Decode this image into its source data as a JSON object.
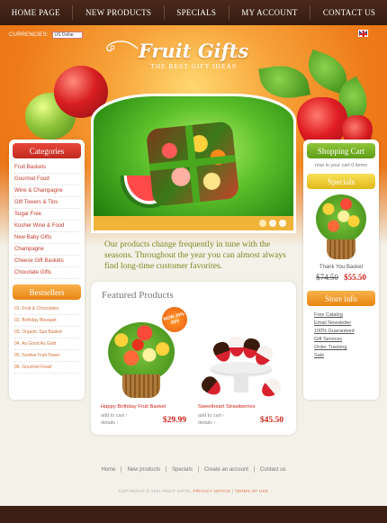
{
  "nav": {
    "items": [
      "HOME PAGE",
      "NEW PRODUCTS",
      "SPECIALS",
      "MY ACCOUNT",
      "CONTACT US"
    ]
  },
  "header": {
    "currencies_label": "CURRENCIES:",
    "currency_value": "US Dollar",
    "logo_title": "Fruit Gifts",
    "logo_subtitle": "THE BEST GIFT IDEAS"
  },
  "intro_text": "Our products change frequently in tune with the seasons. Throughout the year you can almost always find long-time customer favorites.",
  "categories": {
    "title": "Categories",
    "items": [
      "Fruit Baskets",
      "Gourmet Food",
      "Wine & Champagne",
      "Gift Towers & Tins",
      "Sugar Free",
      "Kosher Wine & Food",
      "New Baby Gifts",
      "Champagne",
      "Cheese Gift Baskets",
      "Chocolate Gifts"
    ]
  },
  "bestsellers": {
    "title": "Bestsellers",
    "items": [
      "01. Fruit & Chocolates",
      "02. Birthday Bouquet",
      "03. Organic Spa Basket",
      "04. As Good As Gold",
      "05. Festive Fruit Tower",
      "06. Gourmet Feast"
    ]
  },
  "cart": {
    "title": "Shopping Cart",
    "text": "now in your cart 0 items"
  },
  "specials": {
    "title": "Specials",
    "product_name": "Thank You Basket",
    "old_price": "$74.50",
    "new_price": "$55.50"
  },
  "store_info": {
    "title": "Store info",
    "links": [
      "Free Catalog",
      "Email Newsletter",
      "100% Guaranteed",
      "Gift Services",
      "Order Tracking",
      "Sale"
    ]
  },
  "featured": {
    "title": "Featured Products",
    "badge": "NOW 20% OFF",
    "products": [
      {
        "name": "Happy Birthday Fruit Basket",
        "add_to_cart": "add to cart",
        "details": "details",
        "price": "$29.99"
      },
      {
        "name": "Sweetheart Strawberries",
        "add_to_cart": "add to cart",
        "details": "details",
        "price": "$45.50"
      }
    ]
  },
  "footer": {
    "links": [
      "Home",
      "New products",
      "Specials",
      "Create an account",
      "Contact us"
    ],
    "copyright": "COPYRIGHT © 2011 FRUIT GIFTS.",
    "privacy": "PRIVACY NOTICE",
    "terms": "TERMS OF USE"
  },
  "colors": {
    "nav_bg": "#3d2014",
    "header_orange": "#ee7a18",
    "category_head": "#d0372b",
    "bestseller_head": "#e98512",
    "cart_head": "#5f9c16",
    "specials_head": "#e1b81b",
    "price_red": "#d0251b",
    "intro_green": "#7a8a24"
  }
}
